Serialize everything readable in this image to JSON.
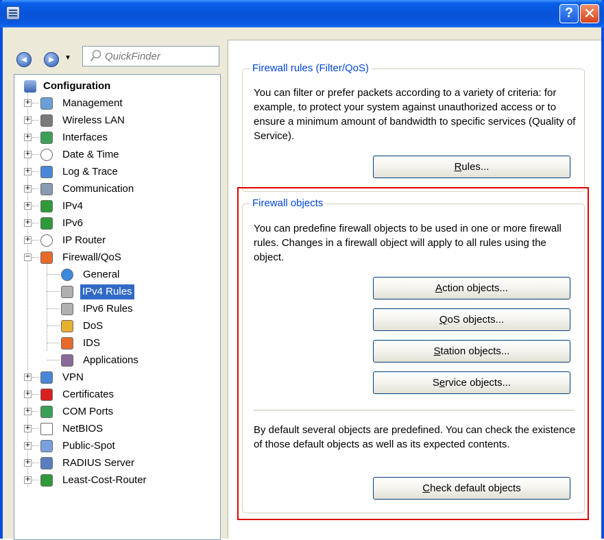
{
  "window": {
    "help_label": "?",
    "close_label": "✕"
  },
  "quickfinder": {
    "placeholder": "QuickFinder"
  },
  "tree": {
    "root_label": "Configuration",
    "items": [
      {
        "label": "Management",
        "icon": "management-icon"
      },
      {
        "label": "Wireless LAN",
        "icon": "wireless-lan-icon"
      },
      {
        "label": "Interfaces",
        "icon": "interfaces-icon"
      },
      {
        "label": "Date & Time",
        "icon": "clock-icon"
      },
      {
        "label": "Log & Trace",
        "icon": "log-icon"
      },
      {
        "label": "Communication",
        "icon": "communication-icon"
      },
      {
        "label": "IPv4",
        "icon": "ipv4-icon"
      },
      {
        "label": "IPv6",
        "icon": "ipv6-icon"
      },
      {
        "label": "IP Router",
        "icon": "router-icon"
      },
      {
        "label": "Firewall/QoS",
        "icon": "firewall-icon"
      },
      {
        "label": "VPN",
        "icon": "vpn-icon"
      },
      {
        "label": "Certificates",
        "icon": "certificate-icon"
      },
      {
        "label": "COM Ports",
        "icon": "com-ports-icon"
      },
      {
        "label": "NetBIOS",
        "icon": "netbios-icon"
      },
      {
        "label": "Public-Spot",
        "icon": "public-spot-icon"
      },
      {
        "label": "RADIUS Server",
        "icon": "radius-server-icon"
      },
      {
        "label": "Least-Cost-Router",
        "icon": "least-cost-router-icon"
      }
    ],
    "firewall_children": [
      {
        "label": "General",
        "icon": "globe-icon"
      },
      {
        "label": "IPv4 Rules",
        "icon": "filter-icon",
        "selected": true
      },
      {
        "label": "IPv6 Rules",
        "icon": "filter-icon"
      },
      {
        "label": "DoS",
        "icon": "dos-icon"
      },
      {
        "label": "IDS",
        "icon": "ids-icon"
      },
      {
        "label": "Applications",
        "icon": "applications-icon"
      }
    ]
  },
  "rules_group": {
    "title": "Firewall rules (Filter/QoS)",
    "description": "You can filter or prefer packets according to a variety of criteria: for example, to protect your system against unauthorized access or to ensure a minimum amount of bandwidth to specific services (Quality of Service).",
    "button": {
      "pre": "",
      "key": "R",
      "post": "ules..."
    }
  },
  "objects_group": {
    "title": "Firewall objects",
    "description": "You can predefine firewall objects to be used in one or more firewall rules. Changes in a firewall object will apply to all rules using the object.",
    "buttons": [
      {
        "pre": "",
        "key": "A",
        "post": "ction objects..."
      },
      {
        "pre": "",
        "key": "Q",
        "post": "oS objects..."
      },
      {
        "pre": "",
        "key": "S",
        "post": "tation objects..."
      },
      {
        "pre": "S",
        "key": "e",
        "post": "rvice objects..."
      }
    ],
    "default_description": "By default several objects are predefined. You can check the existence of those default objects as well as its expected contents.",
    "check_button": {
      "pre": "",
      "key": "C",
      "post": "heck default objects"
    }
  },
  "colors": {
    "titlebar": "#0853d8",
    "group_title": "#0046d5",
    "selection": "#316ac5",
    "highlight_frame": "#e00000"
  }
}
